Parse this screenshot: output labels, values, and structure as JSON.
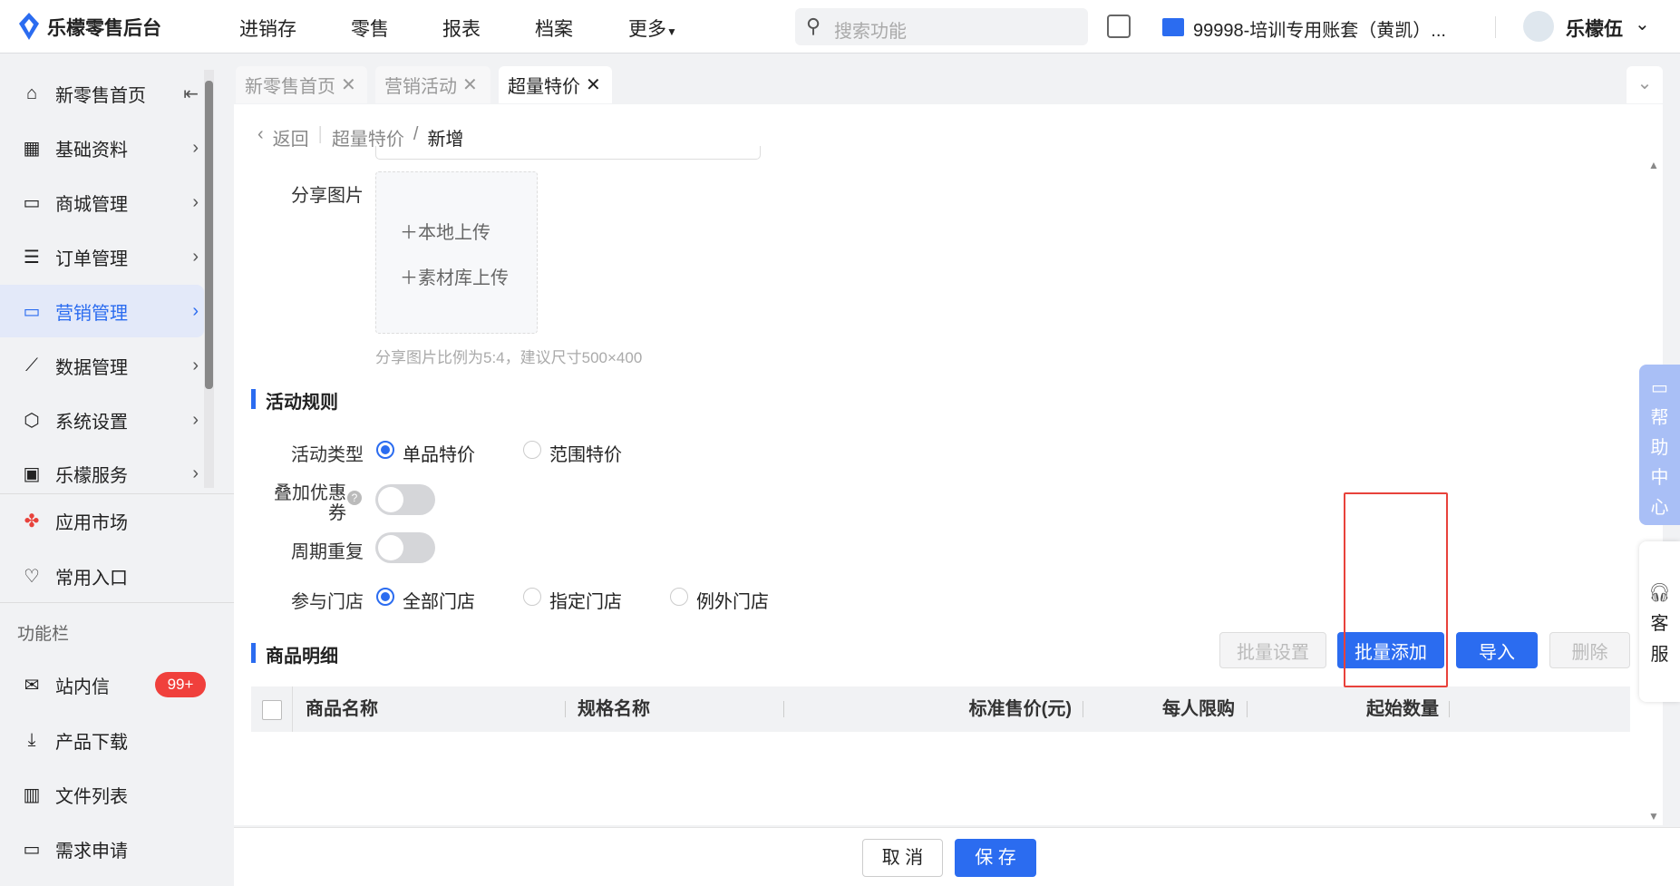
{
  "app": {
    "name": "乐檬零售后台"
  },
  "topnav": [
    "进销存",
    "零售",
    "报表",
    "档案",
    "更多"
  ],
  "search": {
    "placeholder": "搜索功能"
  },
  "account": {
    "name": "99998-培训专用账套（黄凯）...",
    "user": "乐檬伍"
  },
  "sidebar": {
    "items": [
      {
        "label": "新零售首页"
      },
      {
        "label": "基础资料"
      },
      {
        "label": "商城管理"
      },
      {
        "label": "订单管理"
      },
      {
        "label": "营销管理"
      },
      {
        "label": "数据管理"
      },
      {
        "label": "系统设置"
      },
      {
        "label": "乐檬服务"
      }
    ],
    "extra": [
      {
        "label": "应用市场"
      },
      {
        "label": "常用入口"
      }
    ],
    "section": "功能栏",
    "tools": [
      {
        "label": "站内信",
        "badge": "99+"
      },
      {
        "label": "产品下载"
      },
      {
        "label": "文件列表"
      },
      {
        "label": "需求申请"
      }
    ]
  },
  "tabs": [
    {
      "label": "新零售首页"
    },
    {
      "label": "营销活动"
    },
    {
      "label": "超量特价"
    }
  ],
  "breadcrumb": {
    "back": "返回",
    "parent": "超量特价",
    "current": "新增"
  },
  "form": {
    "share_image": "分享图片",
    "upload_local": "＋本地上传",
    "upload_library": "＋素材库上传",
    "hint": "分享图片比例为5:4，建议尺寸500×400",
    "rules_title": "活动规则",
    "type_label": "活动类型",
    "type_options": [
      "单品特价",
      "范围特价"
    ],
    "type_selected": "单品特价",
    "coupon_label_1": "叠加优惠",
    "coupon_label_2": "券",
    "coupon_on": false,
    "repeat_label": "周期重复",
    "repeat_on": false,
    "store_label": "参与门店",
    "store_options": [
      "全部门店",
      "指定门店",
      "例外门店"
    ],
    "store_selected": "全部门店"
  },
  "goods": {
    "title": "商品明细",
    "buttons": [
      "批量设置",
      "批量添加",
      "导入",
      "删除"
    ],
    "columns": [
      "商品名称",
      "规格名称",
      "标准售价(元)",
      "每人限购",
      "起始数量"
    ]
  },
  "footer": {
    "cancel": "取 消",
    "save": "保 存"
  },
  "side_widgets": {
    "help": [
      "帮",
      "助",
      "中",
      "心"
    ],
    "service": [
      "客",
      "服"
    ]
  },
  "colors": {
    "accent": "#2b6cf0",
    "highlight": "#e8423b"
  }
}
